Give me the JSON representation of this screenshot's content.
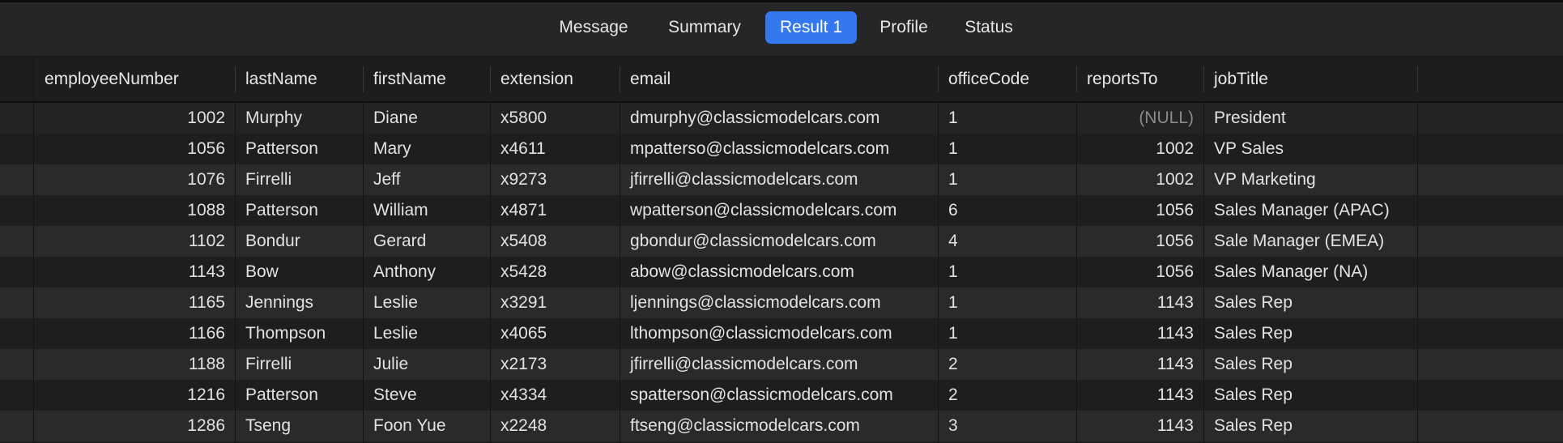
{
  "tabs": [
    {
      "label": "Message",
      "active": false
    },
    {
      "label": "Summary",
      "active": false
    },
    {
      "label": "Result 1",
      "active": true
    },
    {
      "label": "Profile",
      "active": false
    },
    {
      "label": "Status",
      "active": false
    }
  ],
  "colors": {
    "accent": "#3478f0",
    "null_text": "#8a8a8a"
  },
  "table": {
    "columns": [
      "employeeNumber",
      "lastName",
      "firstName",
      "extension",
      "email",
      "officeCode",
      "reportsTo",
      "jobTitle"
    ],
    "rows": [
      [
        "1002",
        "Murphy",
        "Diane",
        "x5800",
        "dmurphy@classicmodelcars.com",
        "1",
        "(NULL)",
        "President"
      ],
      [
        "1056",
        "Patterson",
        "Mary",
        "x4611",
        "mpatterso@classicmodelcars.com",
        "1",
        "1002",
        "VP Sales"
      ],
      [
        "1076",
        "Firrelli",
        "Jeff",
        "x9273",
        "jfirrelli@classicmodelcars.com",
        "1",
        "1002",
        "VP Marketing"
      ],
      [
        "1088",
        "Patterson",
        "William",
        "x4871",
        "wpatterson@classicmodelcars.com",
        "6",
        "1056",
        "Sales Manager (APAC)"
      ],
      [
        "1102",
        "Bondur",
        "Gerard",
        "x5408",
        "gbondur@classicmodelcars.com",
        "4",
        "1056",
        "Sale Manager (EMEA)"
      ],
      [
        "1143",
        "Bow",
        "Anthony",
        "x5428",
        "abow@classicmodelcars.com",
        "1",
        "1056",
        "Sales Manager (NA)"
      ],
      [
        "1165",
        "Jennings",
        "Leslie",
        "x3291",
        "ljennings@classicmodelcars.com",
        "1",
        "1143",
        "Sales Rep"
      ],
      [
        "1166",
        "Thompson",
        "Leslie",
        "x4065",
        "lthompson@classicmodelcars.com",
        "1",
        "1143",
        "Sales Rep"
      ],
      [
        "1188",
        "Firrelli",
        "Julie",
        "x2173",
        "jfirrelli@classicmodelcars.com",
        "2",
        "1143",
        "Sales Rep"
      ],
      [
        "1216",
        "Patterson",
        "Steve",
        "x4334",
        "spatterson@classicmodelcars.com",
        "2",
        "1143",
        "Sales Rep"
      ],
      [
        "1286",
        "Tseng",
        "Foon Yue",
        "x2248",
        "ftseng@classicmodelcars.com",
        "3",
        "1143",
        "Sales Rep"
      ]
    ]
  }
}
